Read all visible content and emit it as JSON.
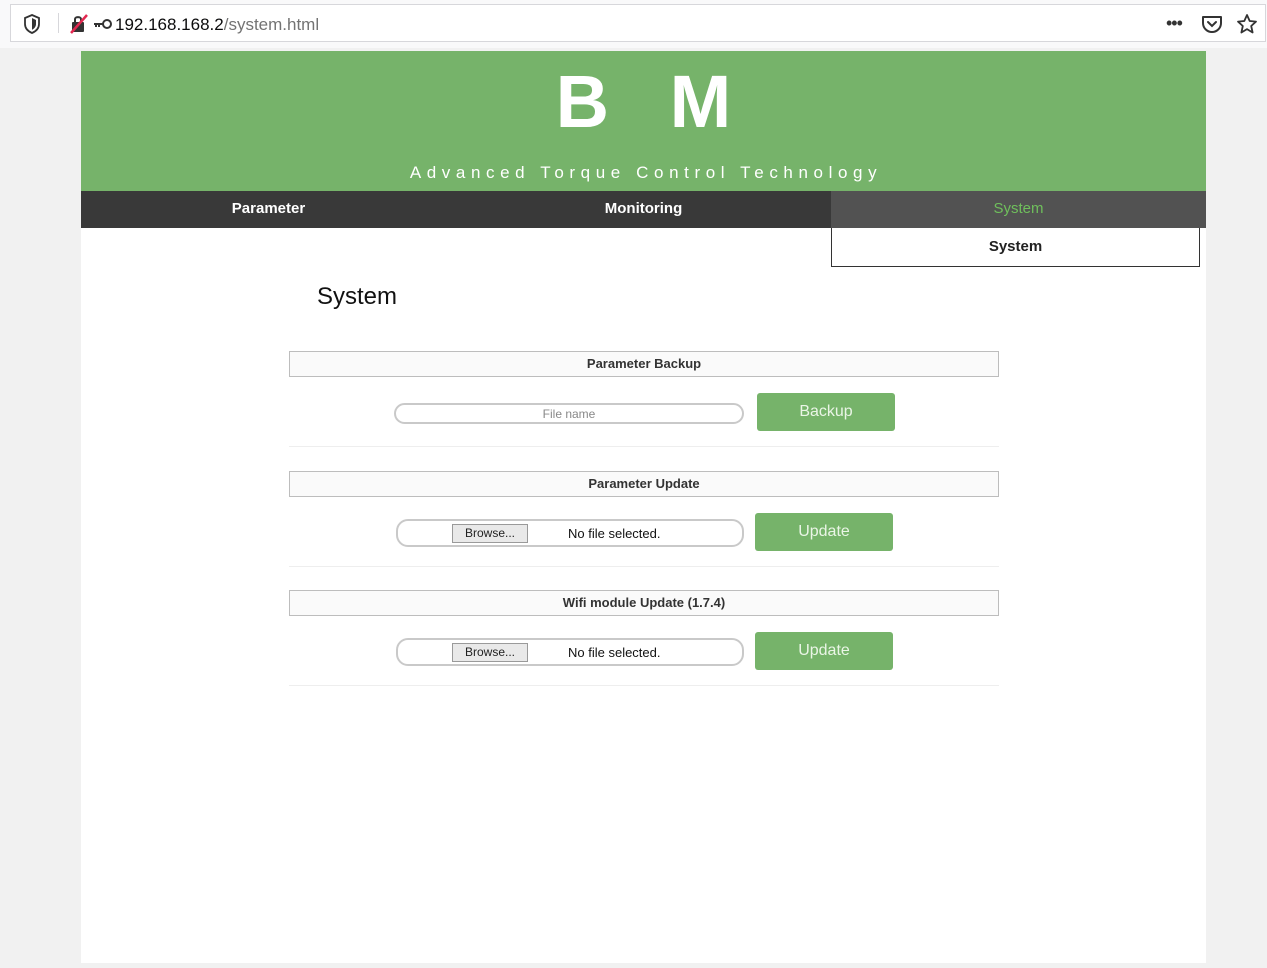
{
  "browser": {
    "url_host": "192.168.168.2",
    "url_path": "/system.html",
    "more_label": "•••"
  },
  "header": {
    "logo": "B M",
    "tagline": "Advanced Torque Control Technology",
    "color": "#76b36a"
  },
  "nav": {
    "items": [
      {
        "label": "Parameter",
        "active": false
      },
      {
        "label": "Monitoring",
        "active": false
      },
      {
        "label": "System",
        "active": true
      }
    ],
    "submenu": [
      "System"
    ]
  },
  "main": {
    "title": "System",
    "backup": {
      "heading": "Parameter Backup",
      "placeholder": "File name",
      "button": "Backup"
    },
    "param_update": {
      "heading": "Parameter Update",
      "browse": "Browse...",
      "status": "No file selected.",
      "button": "Update"
    },
    "wifi_update": {
      "heading": "Wifi module Update (1.7.4)",
      "browse": "Browse...",
      "status": "No file selected.",
      "button": "Update"
    }
  },
  "icons": [
    "shield-icon",
    "insecure-connection-icon",
    "key-icon",
    "more-icon",
    "pocket-icon",
    "bookmark-star-icon"
  ]
}
